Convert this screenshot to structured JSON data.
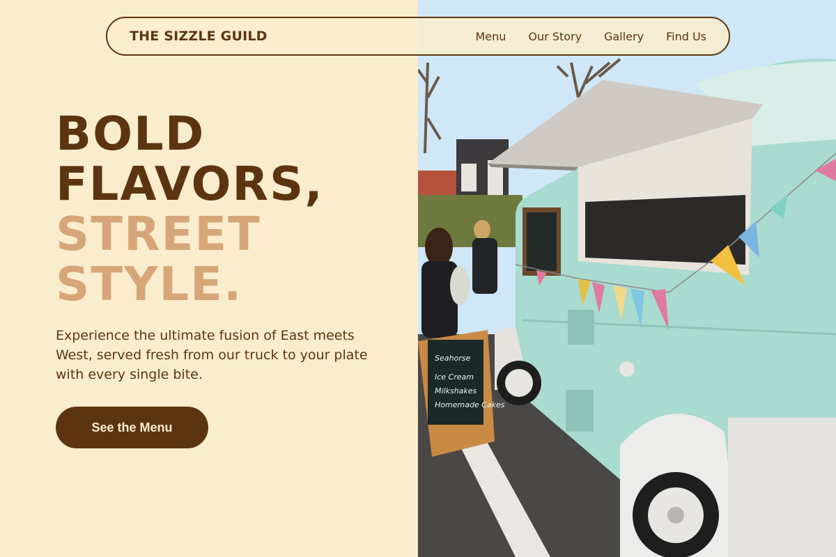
{
  "nav": {
    "brand": "THE SIZZLE GUILD",
    "links": [
      "Menu",
      "Our Story",
      "Gallery",
      "Find Us"
    ]
  },
  "hero": {
    "line1": "BOLD",
    "line2": "FLAVORS,",
    "line3": "STREET",
    "line4": "STYLE.",
    "subtitle": "Experience the ultimate fusion of East meets West, served fresh from our truck to your plate with every single bite.",
    "cta_label": "See the Menu"
  },
  "colors": {
    "background": "#faedce",
    "brown": "#5c3510",
    "tan": "#d6a679",
    "truck": "#a9dbd0"
  }
}
